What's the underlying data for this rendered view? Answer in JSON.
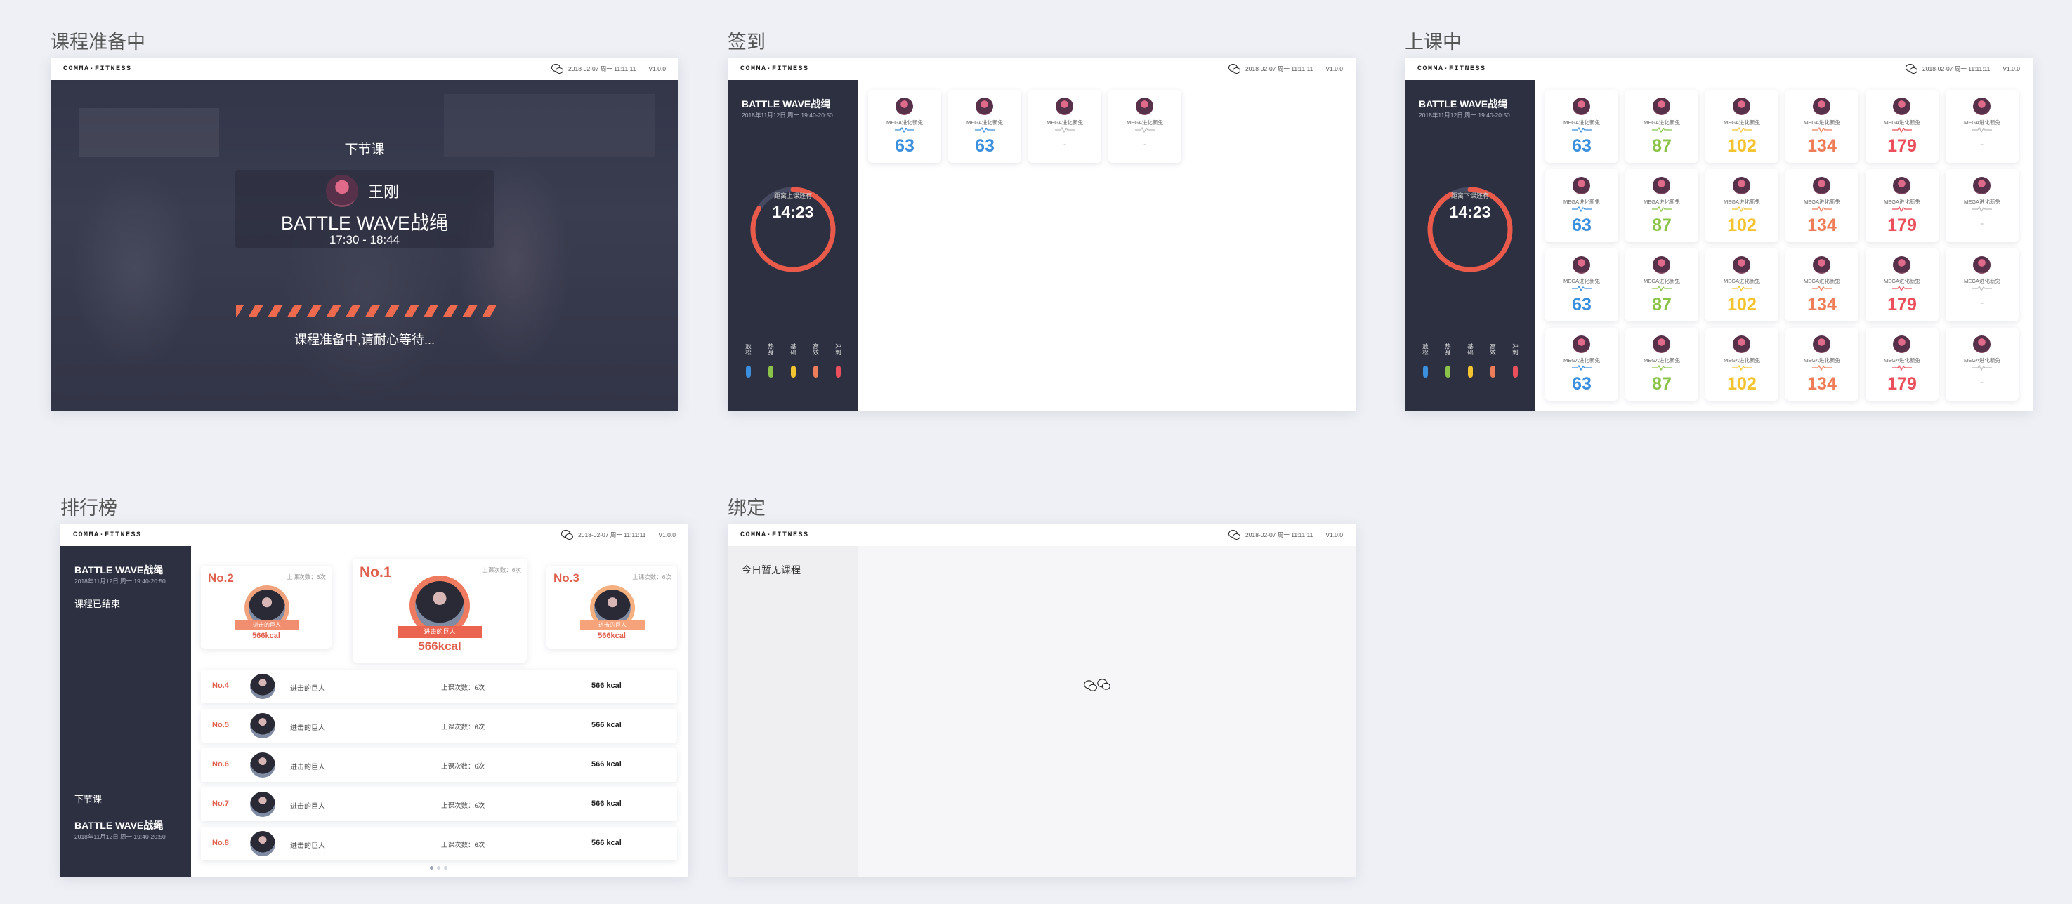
{
  "sections": {
    "prep": "课程准备中",
    "checkin": "签到",
    "inclass": "上课中",
    "ranking": "排行榜",
    "bind": "绑定"
  },
  "topbar": {
    "logo": "COMMA·FITNESS",
    "datetime": "2018-02-07 周一 11:11:11",
    "version": "V1.0.0"
  },
  "prep": {
    "next_label": "下节课",
    "coach": "王刚",
    "course": "BATTLE WAVE战绳",
    "time": "17:30 - 18:44",
    "waiting": "课程准备中,请耐心等待..."
  },
  "session": {
    "course": "BATTLE WAVE战绳",
    "date": "2018年11月12日 周一 19:40-20:50"
  },
  "checkin": {
    "countdown_label": "距离上课还有",
    "countdown": "14:23",
    "cards": [
      {
        "name": "MEGA进化新兔",
        "value": "63"
      },
      {
        "name": "MEGA进化新兔",
        "value": "63"
      },
      {
        "name": "MEGA进化新兔",
        "value": "-"
      },
      {
        "name": "MEGA进化新兔",
        "value": "-"
      }
    ]
  },
  "inclass": {
    "countdown_label": "距离下课还有",
    "countdown": "14:23",
    "card_name": "MEGA进化新兔",
    "columns": [
      "63",
      "87",
      "102",
      "134",
      "179",
      "-"
    ]
  },
  "zones": [
    {
      "label": "放松",
      "color": "#3a8fde"
    },
    {
      "label": "热身",
      "color": "#8bc34a"
    },
    {
      "label": "基础",
      "color": "#f4c430"
    },
    {
      "label": "高效",
      "color": "#ee7d5a"
    },
    {
      "label": "冲刺",
      "color": "#ea4f5b"
    }
  ],
  "ranking": {
    "ended": "课程已结束",
    "next_label": "下节课",
    "next_course": "BATTLE WAVE战绳",
    "next_date": "2018年11月12日 周一 19:40-20:50",
    "podium": [
      {
        "no": "No.2",
        "count": "上课次数：6次",
        "name": "进击的巨人",
        "kcal": "566kcal"
      },
      {
        "no": "No.1",
        "count": "上课次数：6次",
        "name": "进击的巨人",
        "kcal": "566kcal"
      },
      {
        "no": "No.3",
        "count": "上课次数：6次",
        "name": "进击的巨人",
        "kcal": "566kcal"
      }
    ],
    "rows": [
      {
        "no": "No.4",
        "name": "进击的巨人",
        "count": "上课次数：6次",
        "kcal": "566 kcal"
      },
      {
        "no": "No.5",
        "name": "进击的巨人",
        "count": "上课次数：6次",
        "kcal": "566 kcal"
      },
      {
        "no": "No.6",
        "name": "进击的巨人",
        "count": "上课次数：6次",
        "kcal": "566 kcal"
      },
      {
        "no": "No.7",
        "name": "进击的巨人",
        "count": "上课次数：6次",
        "kcal": "566 kcal"
      },
      {
        "no": "No.8",
        "name": "进击的巨人",
        "count": "上课次数：6次",
        "kcal": "566 kcal"
      }
    ]
  },
  "bind": {
    "no_course": "今日暂无课程"
  }
}
